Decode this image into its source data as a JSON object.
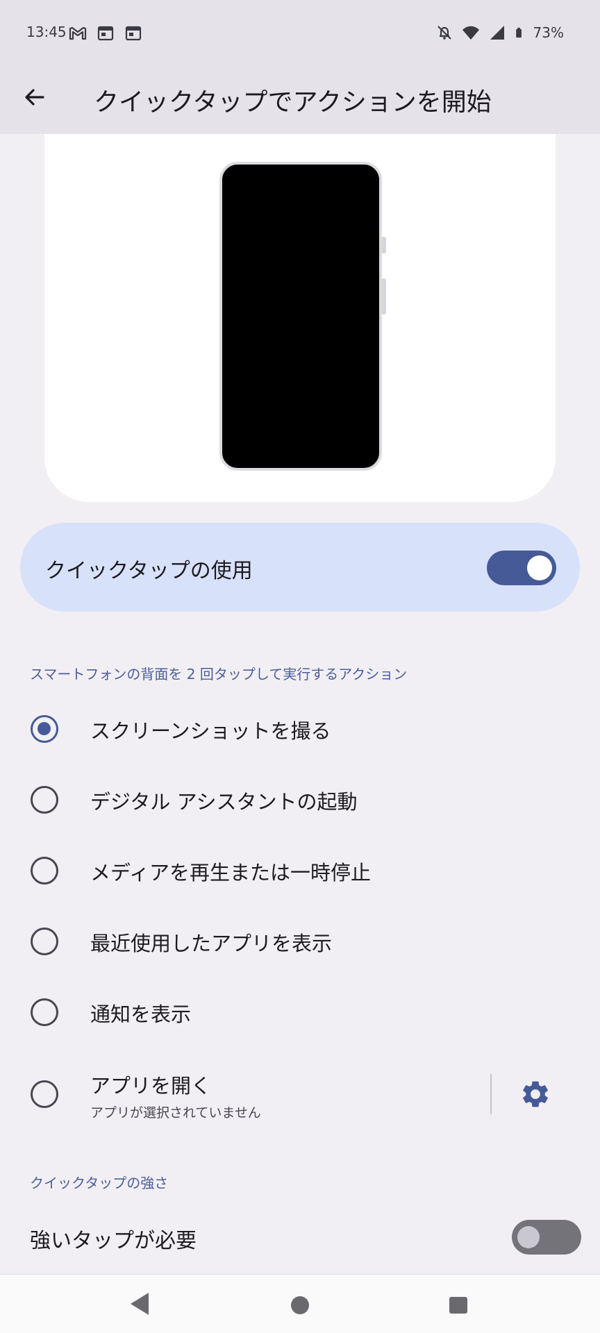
{
  "status_bar": {
    "time": "13:45",
    "battery": "73%",
    "left_icons": [
      "gmail-icon",
      "calendar-icon",
      "calendar-icon"
    ],
    "right_icons": [
      "notifications-off-icon",
      "wifi-icon",
      "signal-icon",
      "battery-icon"
    ]
  },
  "app_bar": {
    "title": "クイックタップでアクションを開始",
    "back_icon": "arrow-back-icon"
  },
  "main_toggle": {
    "label": "クイックタップの使用",
    "enabled": true
  },
  "actions_section": {
    "header": "スマートフォンの背面を 2 回タップして実行するアクション",
    "options": [
      {
        "label": "スクリーンショットを撮る",
        "selected": true
      },
      {
        "label": "デジタル アシスタントの起動",
        "selected": false
      },
      {
        "label": "メディアを再生または一時停止",
        "selected": false
      },
      {
        "label": "最近使用したアプリを表示",
        "selected": false
      },
      {
        "label": "通知を表示",
        "selected": false
      },
      {
        "label": "アプリを開く",
        "subtitle": "アプリが選択されていません",
        "selected": false,
        "settings_icon": "gear-icon"
      }
    ]
  },
  "strength_section": {
    "header": "クイックタップの強さ",
    "strong_tap_label": "強いタップが必要",
    "strong_tap_enabled": false
  },
  "nav_bar": {
    "buttons": [
      "back-icon",
      "home-icon",
      "recents-icon"
    ]
  },
  "colors": {
    "accent": "#455a96",
    "toggle_card": "#d8e1fa",
    "background": "#f2eff4"
  }
}
